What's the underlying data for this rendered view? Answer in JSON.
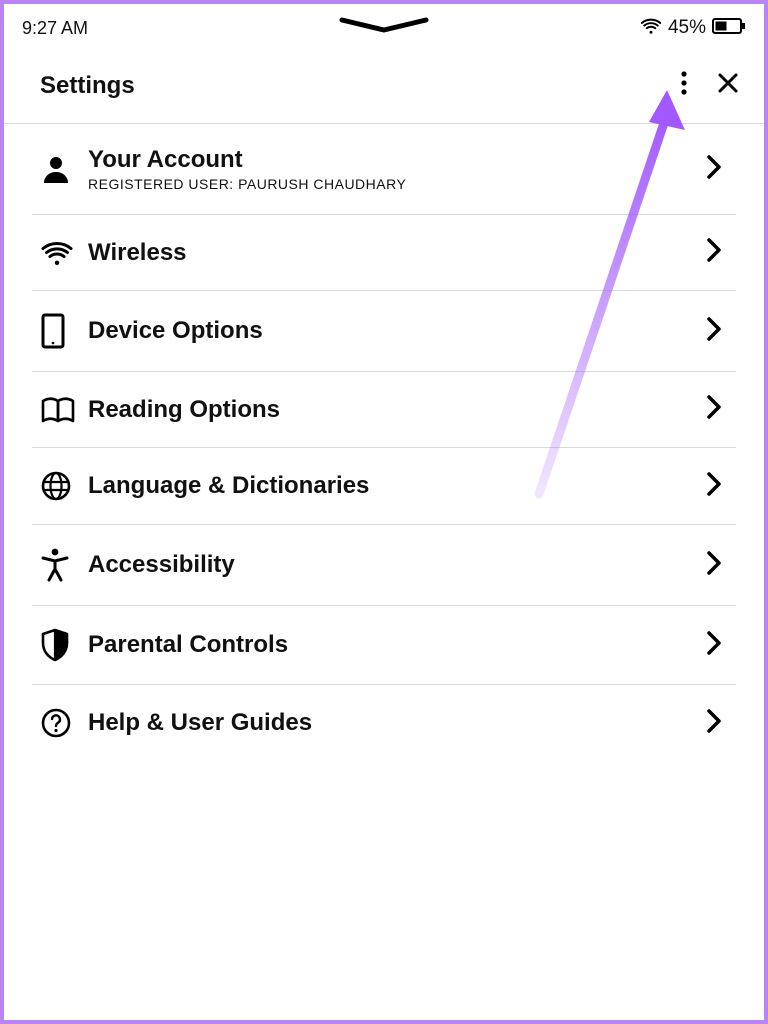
{
  "statusbar": {
    "time": "9:27 AM",
    "battery_percent": "45%"
  },
  "header": {
    "title": "Settings"
  },
  "items": [
    {
      "icon": "user",
      "title": "Your Account",
      "subtitle": "REGISTERED USER: PAURUSH CHAUDHARY"
    },
    {
      "icon": "wifi",
      "title": "Wireless"
    },
    {
      "icon": "tablet",
      "title": "Device Options"
    },
    {
      "icon": "book",
      "title": "Reading Options"
    },
    {
      "icon": "globe",
      "title": "Language & Dictionaries"
    },
    {
      "icon": "accessibility",
      "title": "Accessibility"
    },
    {
      "icon": "shield",
      "title": "Parental Controls"
    },
    {
      "icon": "help",
      "title": "Help & User Guides"
    }
  ],
  "annotation": {
    "color": "#a259ff"
  }
}
